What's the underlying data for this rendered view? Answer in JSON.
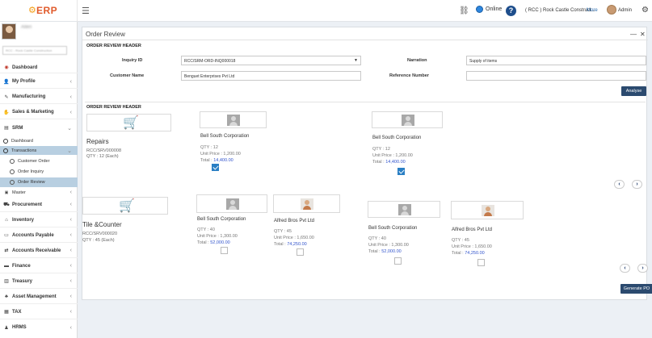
{
  "header": {
    "logo_text": "ERP",
    "menu_icon": "hamburger-icon",
    "online_label": "Online",
    "help_label": "?",
    "company_label": "( RCC ) Rock Castle Construct...",
    "more_label": "More",
    "user_label": "Admin"
  },
  "sidebar": {
    "user_name": "Allen",
    "company_select": "RCC - Rock Castle Construction",
    "items": [
      {
        "label": "Dashboard",
        "icon": "dashboard-icon"
      },
      {
        "label": "My Profile",
        "icon": "user-icon"
      },
      {
        "label": "Manufacturing",
        "icon": "wrench-icon"
      },
      {
        "label": "Sales & Marketing",
        "icon": "handshake-icon"
      },
      {
        "label": "SRM",
        "icon": "srm-icon"
      },
      {
        "label": "Dashboard"
      },
      {
        "label": "Transactions"
      },
      {
        "label": "Customer Order"
      },
      {
        "label": "Order Inquiry"
      },
      {
        "label": "Order Review"
      },
      {
        "label": "Master"
      },
      {
        "label": "Procurement",
        "icon": "truck-icon"
      },
      {
        "label": "Inventory",
        "icon": "box-icon"
      },
      {
        "label": "Accounts Payable",
        "icon": "payable-icon"
      },
      {
        "label": "Accounts Receivable",
        "icon": "receivable-icon"
      },
      {
        "label": "Finance",
        "icon": "finance-icon"
      },
      {
        "label": "Treasury",
        "icon": "treasury-icon"
      },
      {
        "label": "Asset Management",
        "icon": "asset-icon"
      },
      {
        "label": "TAX",
        "icon": "tax-icon"
      },
      {
        "label": "HRMS",
        "icon": "hrms-icon"
      }
    ]
  },
  "panel": {
    "title": "Order Review",
    "header_section": "ORDER REVIEW HEADER",
    "inquiry_id_label": "Inquiry ID",
    "inquiry_id_value": "RCC/SRM-ORD-INQ000018",
    "customer_name_label": "Customer Name",
    "customer_name_value": "Benguet Enterprises Pvt Ltd",
    "narration_label": "Narration",
    "narration_value": "Supply of items",
    "reference_label": "Reference Number",
    "reference_value": "",
    "analyse_button": "Analyse",
    "detail_section": "ORDER REVIEW HEADER",
    "generate_po_button": "Generate PO"
  },
  "items": [
    {
      "name": "Repairs",
      "code": "RCC/SRV000008",
      "qty": "QTY : 12 (Each)",
      "vendors": [
        {
          "name": "Bell South Corporation",
          "qty": "QTY : 12",
          "unit_price": "Unit Price : 1,200.00",
          "total_label": "Total :",
          "total": "14,400.00",
          "checked": true
        },
        {
          "name": "Bell South Corporation",
          "qty": "QTY : 12",
          "unit_price": "Unit Price : 1,200.00",
          "total_label": "Total :",
          "total": "14,400.00",
          "checked": true
        }
      ]
    },
    {
      "name": "Tile &Counter",
      "code": "RCC/SRV000020",
      "qty": "QTY : 45 (Each)",
      "vendors": [
        {
          "name": "Bell South Corporation",
          "qty": "QTY : 40",
          "unit_price": "Unit Price : 1,300.00",
          "total_label": "Total :",
          "total": "52,000.00",
          "checked": false
        },
        {
          "name": "Alfred Bros Pvt Ltd",
          "qty": "QTY : 45",
          "unit_price": "Unit Price : 1,650.00",
          "total_label": "Total :",
          "total": "74,250.00",
          "checked": false
        },
        {
          "name": "Bell South Corporation",
          "qty": "QTY : 40",
          "unit_price": "Unit Price : 1,300.00",
          "total_label": "Total :",
          "total": "52,000.00",
          "checked": false
        },
        {
          "name": "Alfred Bros Pvt Ltd",
          "qty": "QTY : 45",
          "unit_price": "Unit Price : 1,650.00",
          "total_label": "Total :",
          "total": "74,250.00",
          "checked": false
        }
      ]
    }
  ]
}
